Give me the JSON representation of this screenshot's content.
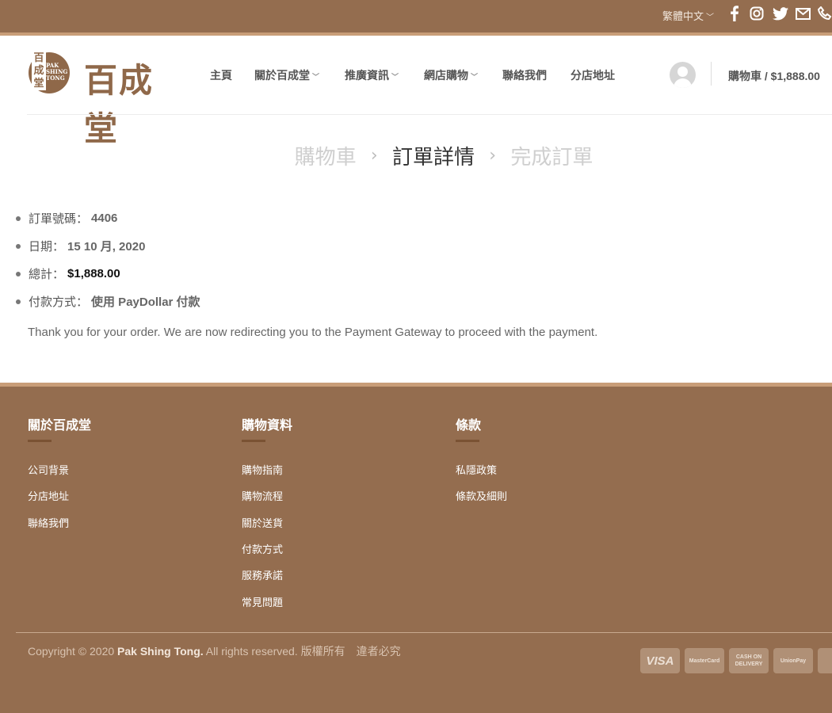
{
  "topbar": {
    "language": "繁體中文",
    "social": [
      "facebook-icon",
      "instagram-icon",
      "twitter-icon",
      "email-icon",
      "phone-icon"
    ]
  },
  "header": {
    "logo_zh": "百成堂",
    "logo_zh_small": "百成堂",
    "logo_en": "PAK SHING TONG",
    "nav": {
      "home": "主頁",
      "about": "關於百成堂",
      "promotions": "推廣資訊",
      "shop": "網店購物",
      "contact": "聯絡我們",
      "branches": "分店地址"
    },
    "cart": "購物車 / $1,888.00"
  },
  "checkout_steps": {
    "cart": "購物車",
    "details": "訂單詳情",
    "complete": "完成訂單"
  },
  "order": {
    "number_label": "訂單號碼：",
    "number": "4406",
    "date_label": "日期：",
    "date": "15 10 月, 2020",
    "total_label": "總計：",
    "total": "$1,888.00",
    "payment_label": "付款方式：",
    "payment": "使用 PayDollar 付款",
    "message": "Thank you for your order. We are now redirecting you to the Payment Gateway to proceed with the payment."
  },
  "footer": {
    "col1": {
      "title": "關於百成堂",
      "links": [
        "公司背景",
        "分店地址",
        "聯絡我們"
      ]
    },
    "col2": {
      "title": "購物資料",
      "links": [
        "購物指南",
        "購物流程",
        "關於送貨",
        "付款方式",
        "服務承諾",
        "常見問題"
      ]
    },
    "col3": {
      "title": "條款",
      "links": [
        "私隱政策",
        "條款及細則"
      ]
    },
    "copyright_pre": "Copyright © 2020 ",
    "copyright_brand": "Pak Shing Tong.",
    "copyright_post": " All rights reserved. 版權所有　違者必究",
    "payment_icons": [
      "VISA",
      "MasterCard",
      "CASH ON DELIVERY",
      "UnionPay"
    ]
  },
  "colors": {
    "brand_brown": "#946d4f",
    "accent_tan": "#c89d78"
  }
}
